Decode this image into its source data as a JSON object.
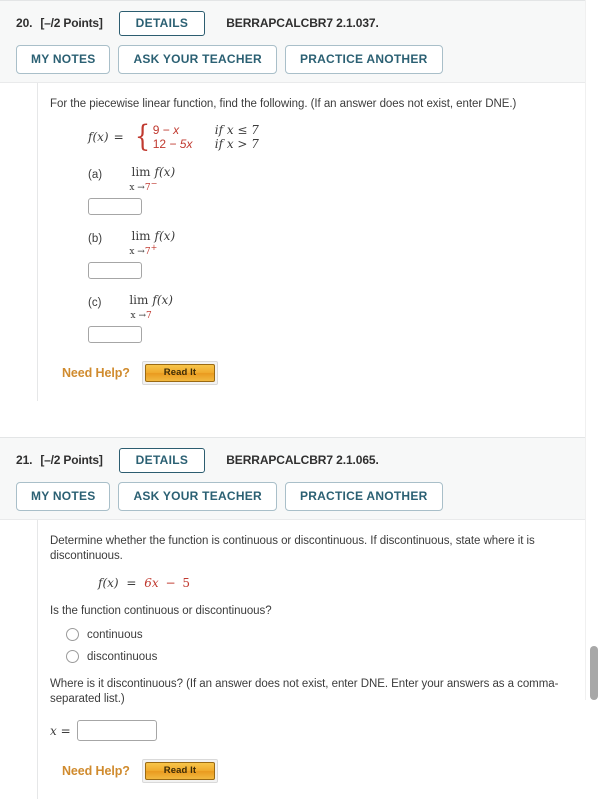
{
  "problems": [
    {
      "number": "20.",
      "points": "[–/2 Points]",
      "details_label": "DETAILS",
      "code": "BERRAPCALCBR7 2.1.037.",
      "my_notes_label": "MY NOTES",
      "ask_teacher_label": "ASK YOUR TEACHER",
      "practice_label": "PRACTICE ANOTHER",
      "prompt": "For the piecewise linear function, find the following. (If an answer does not exist, enter DNE.)",
      "function": {
        "name": "f(x)",
        "equals": "=",
        "cases": [
          {
            "expr_num": "9",
            "expr_op": "−",
            "expr_var": "x",
            "condition": "if x ≤ 7"
          },
          {
            "expr_num": "12",
            "expr_op": "−",
            "expr_var": "5x",
            "condition": "if x > 7"
          }
        ]
      },
      "parts": [
        {
          "label": "(a)",
          "lim": "lim",
          "fn": "f(x)",
          "approach": "x →",
          "target": "7",
          "side": "−",
          "answer": ""
        },
        {
          "label": "(b)",
          "lim": "lim",
          "fn": "f(x)",
          "approach": "x →",
          "target": "7",
          "side": "+",
          "answer": ""
        },
        {
          "label": "(c)",
          "lim": "lim",
          "fn": "f(x)",
          "approach": "x →",
          "target": "7",
          "side": "",
          "answer": ""
        }
      ],
      "need_help_label": "Need Help?",
      "read_it_label": "Read It"
    },
    {
      "number": "21.",
      "points": "[–/2 Points]",
      "details_label": "DETAILS",
      "code": "BERRAPCALCBR7 2.1.065.",
      "my_notes_label": "MY NOTES",
      "ask_teacher_label": "ASK YOUR TEACHER",
      "practice_label": "PRACTICE ANOTHER",
      "prompt": "Determine whether the function is continuous or discontinuous. If discontinuous, state where it is discontinuous.",
      "function_text": {
        "name": "f(x)",
        "equals": "=",
        "expr_a": "6x",
        "expr_op": "−",
        "expr_b": "5"
      },
      "question1": "Is the function continuous or discontinuous?",
      "options": [
        {
          "label": "continuous",
          "selected": false
        },
        {
          "label": "discontinuous",
          "selected": false
        }
      ],
      "question2": "Where is it discontinuous? (If an answer does not exist, enter DNE. Enter your answers as a comma-separated list.)",
      "x_label": "x =",
      "x_value": "",
      "need_help_label": "Need Help?",
      "read_it_label": "Read It"
    }
  ],
  "colors": {
    "accent_teal": "#2b6073",
    "math_red": "#c0392f",
    "need_help_orange": "#d08b2e",
    "header_bg": "#f7f8f8"
  }
}
